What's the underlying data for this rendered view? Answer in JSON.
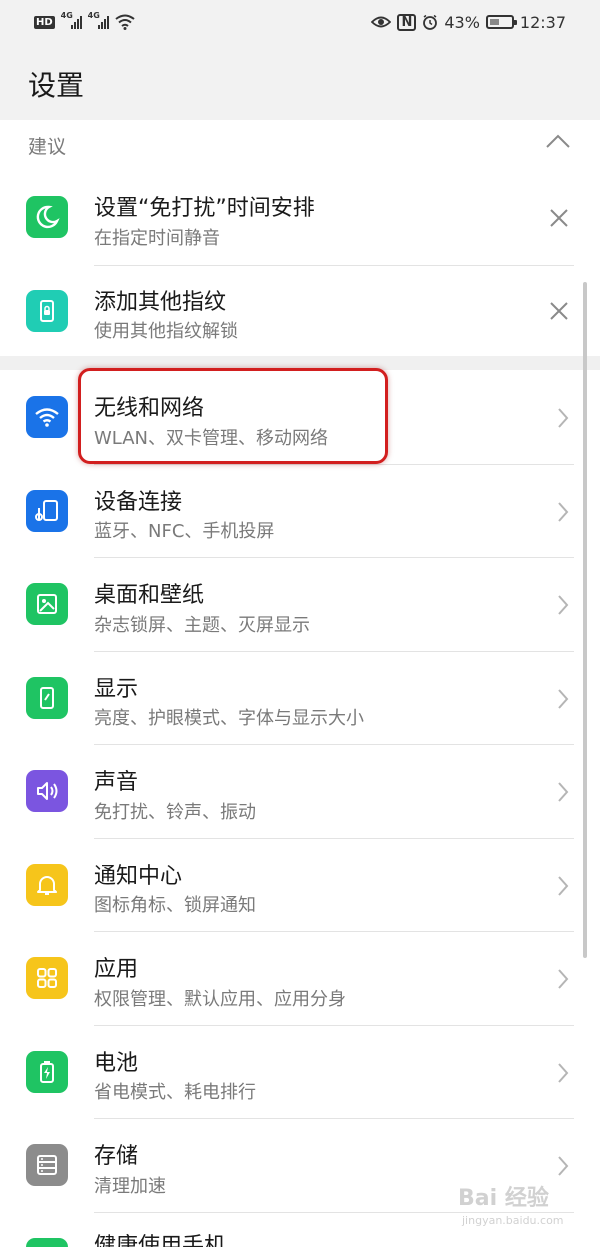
{
  "status_bar": {
    "hd": "HD",
    "sim1_label": "4G",
    "sim2_label": "4G",
    "nfc": "N",
    "battery": "43%",
    "battery_level": 0.43,
    "time": "12:37",
    "icons": [
      "signal-icon",
      "wifi-icon",
      "eye-icon",
      "nfc-icon",
      "alarm-icon",
      "battery-icon"
    ]
  },
  "header": {
    "title": "设置"
  },
  "suggestions": {
    "label": "建议",
    "items": [
      {
        "title": "设置“免打扰”时间安排",
        "subtitle": "在指定时间静音",
        "icon": "moon-icon",
        "color": "#1fc463"
      },
      {
        "title": "添加其他指纹",
        "subtitle": "使用其他指纹解锁",
        "icon": "fingerprint-lock-icon",
        "color": "#20cdb4"
      }
    ]
  },
  "settings": {
    "items": [
      {
        "title": "无线和网络",
        "subtitle": "WLAN、双卡管理、移动网络",
        "icon": "wifi-icon",
        "color": "#1a73e8"
      },
      {
        "title": "设备连接",
        "subtitle": "蓝牙、NFC、手机投屏",
        "icon": "device-connection-icon",
        "color": "#1a73e8"
      },
      {
        "title": "桌面和壁纸",
        "subtitle": "杂志锁屏、主题、灭屏显示",
        "icon": "wallpaper-icon",
        "color": "#1fc463"
      },
      {
        "title": "显示",
        "subtitle": "亮度、护眼模式、字体与显示大小",
        "icon": "display-icon",
        "color": "#1fc463"
      },
      {
        "title": "声音",
        "subtitle": "免打扰、铃声、振动",
        "icon": "speaker-icon",
        "color": "#7b55e0"
      },
      {
        "title": "通知中心",
        "subtitle": "图标角标、锁屏通知",
        "icon": "bell-icon",
        "color": "#f6c51b"
      },
      {
        "title": "应用",
        "subtitle": "权限管理、默认应用、应用分身",
        "icon": "apps-grid-icon",
        "color": "#f6c51b"
      },
      {
        "title": "电池",
        "subtitle": "省电模式、耗电排行",
        "icon": "battery-charging-icon",
        "color": "#1fc463"
      },
      {
        "title": "存储",
        "subtitle": "清理加速",
        "icon": "storage-icon",
        "color": "#8c8c8c"
      },
      {
        "title": "健康使用手机",
        "subtitle": "",
        "icon": "health-icon",
        "color": "#1fc463"
      }
    ]
  },
  "watermark": {
    "text": "Bai 经验",
    "sub": "jingyan.baidu.com"
  }
}
